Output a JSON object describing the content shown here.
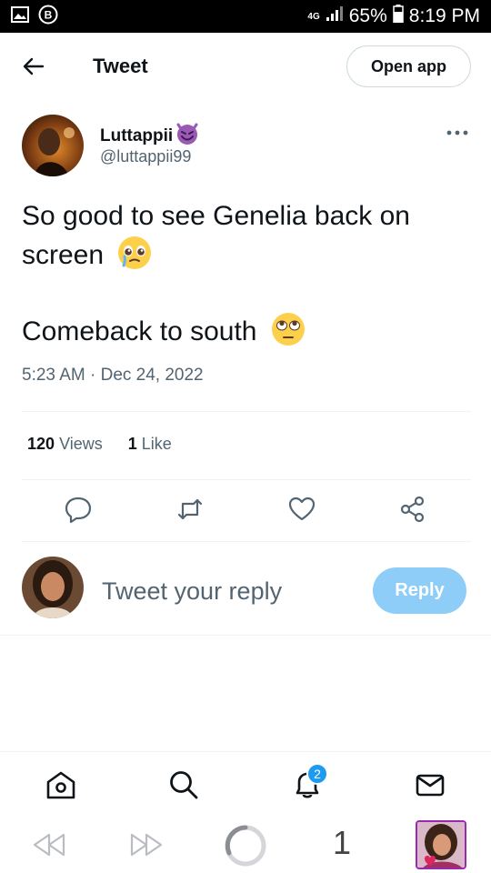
{
  "status_bar": {
    "network": "4G",
    "battery": "65%",
    "time": "8:19 PM",
    "icons": [
      "gallery-icon",
      "b-app-icon",
      "signal-icon",
      "battery-icon"
    ]
  },
  "header": {
    "title": "Tweet",
    "open_app_label": "Open app"
  },
  "author": {
    "name": "Luttappii",
    "handle": "@luttappii99",
    "name_emoji": "smiling-devil-emoji"
  },
  "tweet": {
    "line1": "So good to see Genelia back on screen",
    "line1_emoji": "pleading-face-emoji",
    "line2": "Comeback to south",
    "line2_emoji": "eye-roll-emoji",
    "timestamp": "5:23 AM · Dec 24, 2022"
  },
  "stats": {
    "views_count": "120",
    "views_label": "Views",
    "likes_count": "1",
    "likes_label": "Like"
  },
  "actions": [
    "reply-icon",
    "retweet-icon",
    "like-icon",
    "share-icon"
  ],
  "reply": {
    "placeholder": "Tweet your reply",
    "button_label": "Reply"
  },
  "bottom_nav": {
    "items": [
      "home-icon",
      "search-icon",
      "notifications-icon",
      "messages-icon"
    ],
    "notification_badge": "2"
  },
  "browser_bar": {
    "tab_count": "1"
  },
  "colors": {
    "accent": "#1d9bf0",
    "reply_button": "#8ecdf8",
    "secondary_text": "#536471",
    "primary_text": "#0f1419"
  }
}
